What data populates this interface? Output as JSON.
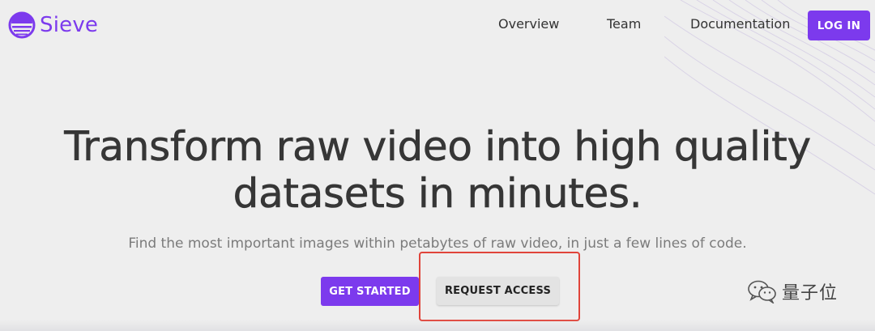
{
  "brand": {
    "name": "Sieve",
    "accent_color": "#7c3aed"
  },
  "nav": {
    "items": [
      "Overview",
      "Team",
      "Documentation"
    ],
    "login_label": "LOG IN"
  },
  "hero": {
    "headline_line1": "Transform raw video into high quality",
    "headline_line2": "datasets in minutes.",
    "subtitle": "Find the most important images within petabytes of raw video, in just a few lines of code.",
    "primary_button": "GET STARTED",
    "secondary_button": "REQUEST ACCESS"
  },
  "annotation": {
    "highlight_color": "#e0443a"
  },
  "watermark": {
    "text": "量子位",
    "icon": "wechat-icon"
  }
}
